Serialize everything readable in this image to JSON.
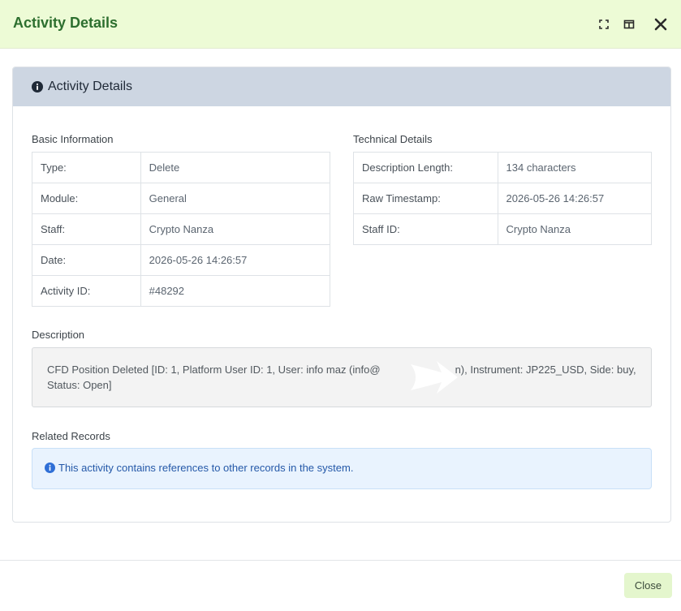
{
  "modal": {
    "title": "Activity Details",
    "controls": {
      "fullscreen_icon": "fullscreen-icon",
      "split_icon": "split-view-icon",
      "close_icon": "close-icon"
    }
  },
  "card": {
    "title": "Activity Details",
    "title_icon": "info-icon"
  },
  "basic_info": {
    "heading": "Basic Information",
    "rows": [
      {
        "key": "Type:",
        "value": "Delete"
      },
      {
        "key": "Module:",
        "value": "General"
      },
      {
        "key": "Staff:",
        "value": "Crypto Nanza"
      },
      {
        "key": "Date:",
        "value": "2026-05-26 14:26:57"
      },
      {
        "key": "Activity ID:",
        "value": "#48292"
      }
    ]
  },
  "technical": {
    "heading": "Technical Details",
    "rows": [
      {
        "key": "Description Length:",
        "value": "134 characters"
      },
      {
        "key": "Raw Timestamp:",
        "value": "2026-05-26 14:26:57"
      },
      {
        "key": "Staff ID:",
        "value": "Crypto Nanza"
      }
    ]
  },
  "description": {
    "heading": "Description",
    "text_before": "CFD Position Deleted [ID: 1, Platform User ID: 1, User: info maz (info@",
    "text_after": "n), Instrument: JP225_USD, Side: buy,",
    "text_line2": "Status: Open]"
  },
  "related": {
    "heading": "Related Records",
    "alert_text": "This activity contains references to other records in the system."
  },
  "footer": {
    "close_label": "Close"
  },
  "colors": {
    "header_bg": "#edfbd6",
    "title_green": "#2d6f2f",
    "card_header_bg": "#cdd6e2",
    "alert_bg": "#e9f3fe",
    "alert_text": "#2458a8",
    "close_btn_bg": "#e4f6cd"
  }
}
